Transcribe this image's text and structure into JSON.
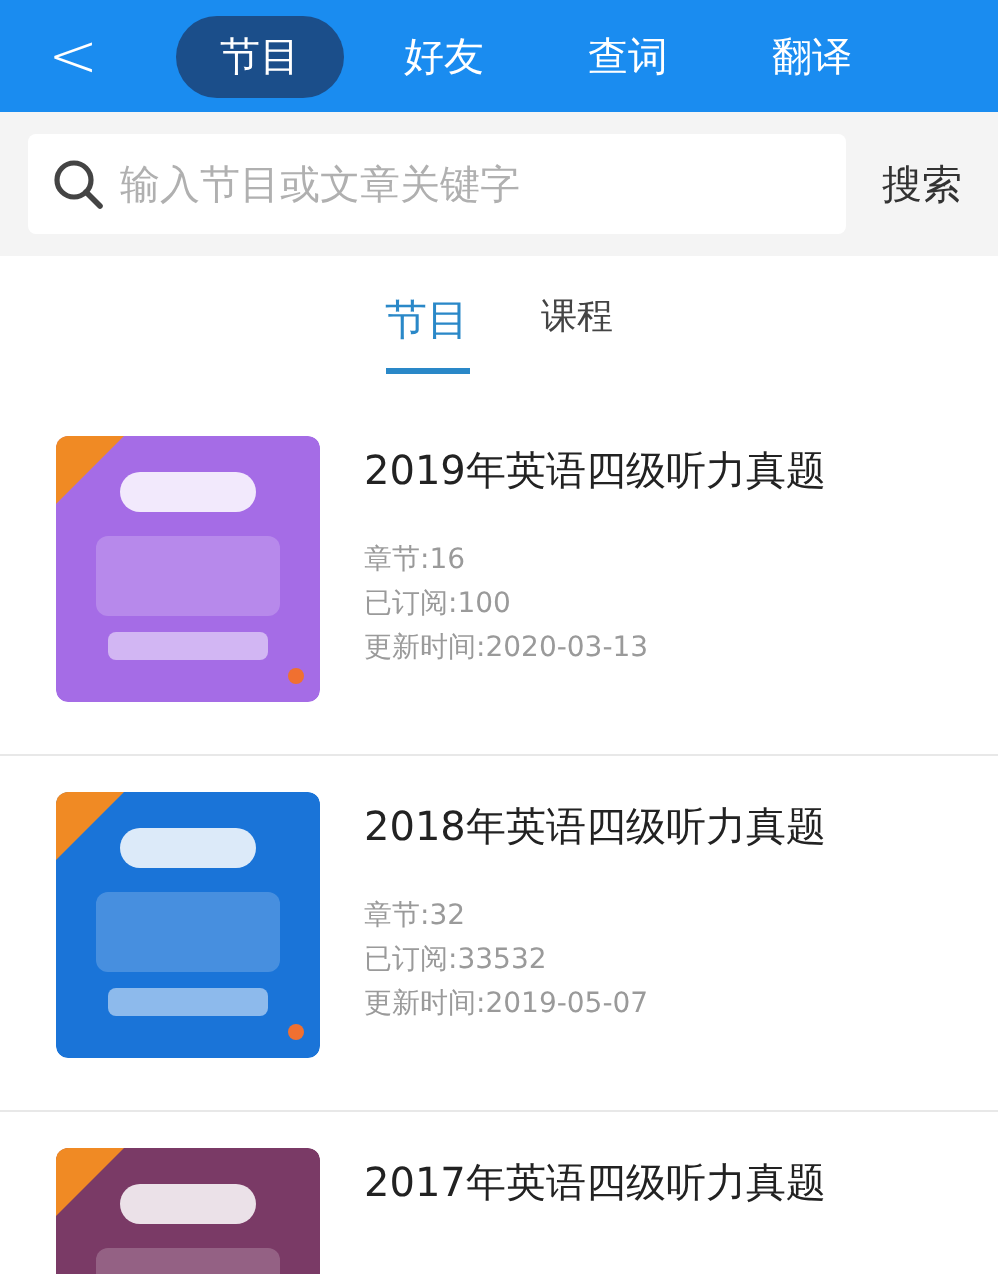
{
  "header": {
    "back": "<",
    "tabs": [
      {
        "label": "节目",
        "selected": true
      },
      {
        "label": "好友",
        "selected": false
      },
      {
        "label": "查词",
        "selected": false
      },
      {
        "label": "翻译",
        "selected": false
      }
    ]
  },
  "search": {
    "placeholder": "输入节目或文章关键字",
    "button": "搜索"
  },
  "subtabs": [
    {
      "label": "节目",
      "selected": true
    },
    {
      "label": "课程",
      "selected": false
    }
  ],
  "programs": [
    {
      "title": "2019年英语四级听力真题",
      "chapters": "章节:16",
      "subscribed": "已订阅:100",
      "updated": "更新时间:2020-03-13"
    },
    {
      "title": "2018年英语四级听力真题",
      "chapters": "章节:32",
      "subscribed": "已订阅:33532",
      "updated": "更新时间:2019-05-07"
    },
    {
      "title": "2017年英语四级听力真题"
    }
  ]
}
